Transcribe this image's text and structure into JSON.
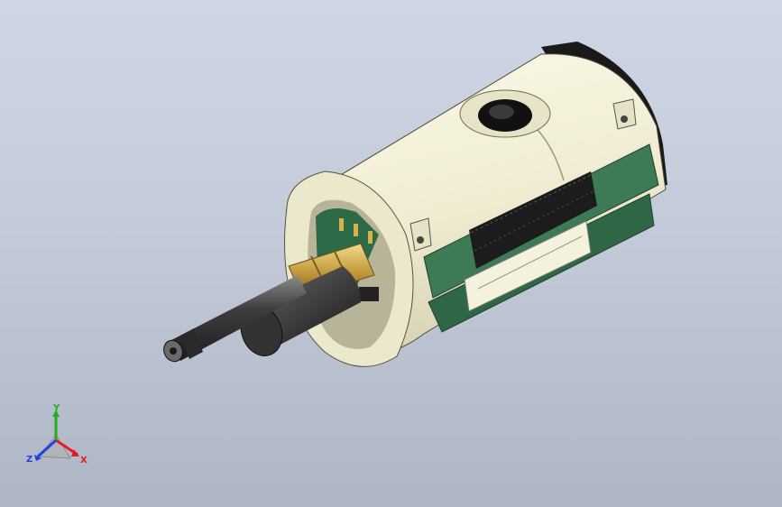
{
  "triad": {
    "x_label": "X",
    "y_label": "Y",
    "z_label": "Z"
  },
  "colors": {
    "background_top": "#cfd6e3",
    "background_bottom": "#aeb5c4",
    "housing_body": "#f1eed6",
    "housing_shadow": "#d9d5b8",
    "pcb_green": "#3f7a57",
    "header_black": "#1c1c1c",
    "axis_x": "#e02020",
    "axis_y": "#20b020",
    "axis_z": "#2040e0",
    "brass": "#c9a44a",
    "rod": "#5b5b5b"
  }
}
